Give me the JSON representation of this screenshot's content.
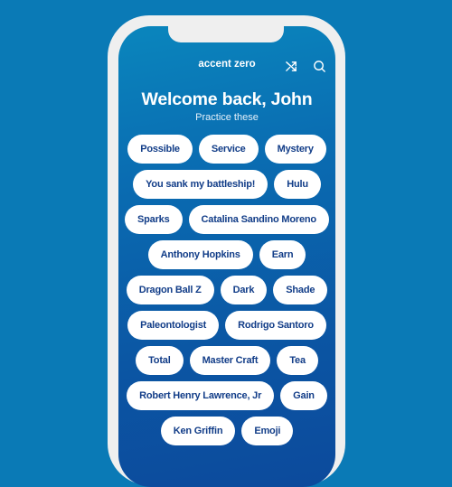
{
  "header": {
    "app_title": "accent zero",
    "icons": [
      "shuffle-icon",
      "search-icon"
    ]
  },
  "main": {
    "welcome": "Welcome back, John",
    "subtitle": "Practice these",
    "chip_rows": [
      [
        "Possible",
        "Service",
        "Mystery"
      ],
      [
        "You sank my battleship!",
        "Hulu"
      ],
      [
        "Sparks",
        "Catalina Sandino Moreno"
      ],
      [
        "Anthony Hopkins",
        "Earn"
      ],
      [
        "Dragon Ball Z",
        "Dark",
        "Shade"
      ],
      [
        "Paleontologist",
        "Rodrigo Santoro"
      ],
      [
        "Total",
        "Master Craft",
        "Tea"
      ],
      [
        "Robert Henry Lawrence, Jr",
        "Gain"
      ],
      [
        "Ken Griffin",
        "Emoji"
      ]
    ]
  },
  "colors": {
    "background": "#0a7ab6",
    "chip_text": "#123d88",
    "frame": "#efefef"
  }
}
